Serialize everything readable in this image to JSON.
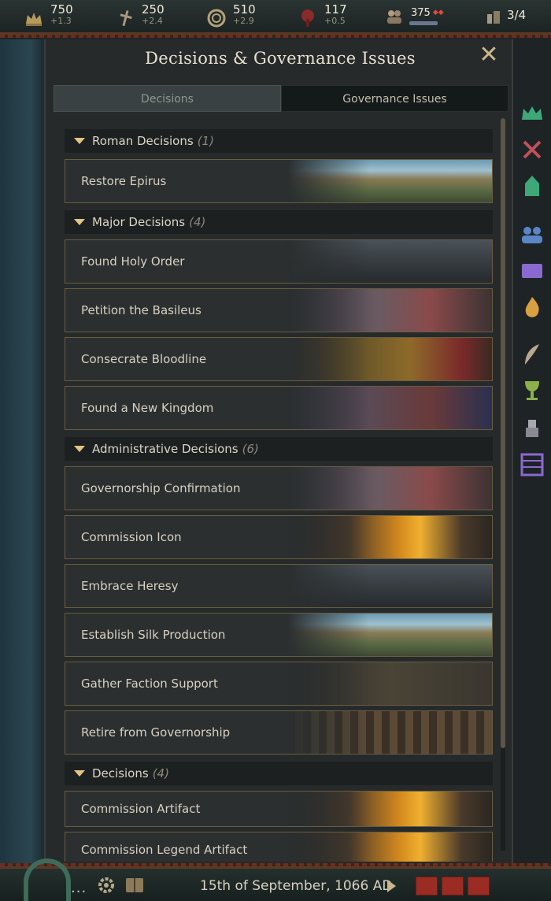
{
  "resources": [
    {
      "icon": "crown-icon",
      "value": "750",
      "delta": "+1.3"
    },
    {
      "icon": "cross-icon",
      "value": "250",
      "delta": "+2.4"
    },
    {
      "icon": "prestige-icon",
      "value": "510",
      "delta": "+2.9"
    },
    {
      "icon": "tree-icon",
      "value": "117",
      "delta": "+0.5"
    },
    {
      "icon": "army-icon",
      "value": "375",
      "delta": ""
    },
    {
      "icon": "domain-icon",
      "value": "3/4",
      "delta": ""
    }
  ],
  "panel": {
    "title": "Decisions & Governance Issues",
    "tabs": [
      "Decisions",
      "Governance Issues"
    ],
    "active_tab": "Decisions"
  },
  "categories": [
    {
      "title": "Roman Decisions",
      "count": "(1)"
    },
    {
      "title": "Major Decisions",
      "count": "(4)"
    },
    {
      "title": "Administrative Decisions",
      "count": "(6)"
    },
    {
      "title": "Decisions",
      "count": "(4)"
    }
  ],
  "decisions": [
    "Restore Epirus",
    "Found Holy Order",
    "Petition the Basileus",
    "Consecrate Bloodline",
    "Found a New Kingdom",
    "Governorship Confirmation",
    "Commission Icon",
    "Embrace Heresy",
    "Establish Silk Production",
    "Gather Faction Support",
    "Retire from Governorship",
    "Commission Artifact",
    "Commission Legend Artifact"
  ],
  "sidebar_icons": [
    "crown-icon",
    "crossed-swords-icon",
    "tower-icon",
    "council-icon",
    "scroll-icon",
    "flame-icon",
    "quill-icon",
    "chalice-icon",
    "king-piece-icon",
    "abacus-icon"
  ],
  "bottom": {
    "menu_dots": "...",
    "date": "15th of September, 1066 AD"
  },
  "colors": {
    "accent_gold": "#e3c484",
    "frame_gold": "#6a5c40",
    "speed_red": "#9a2c24",
    "sidebar_green": "#3ea878",
    "sidebar_purple": "#8a6ad0"
  }
}
